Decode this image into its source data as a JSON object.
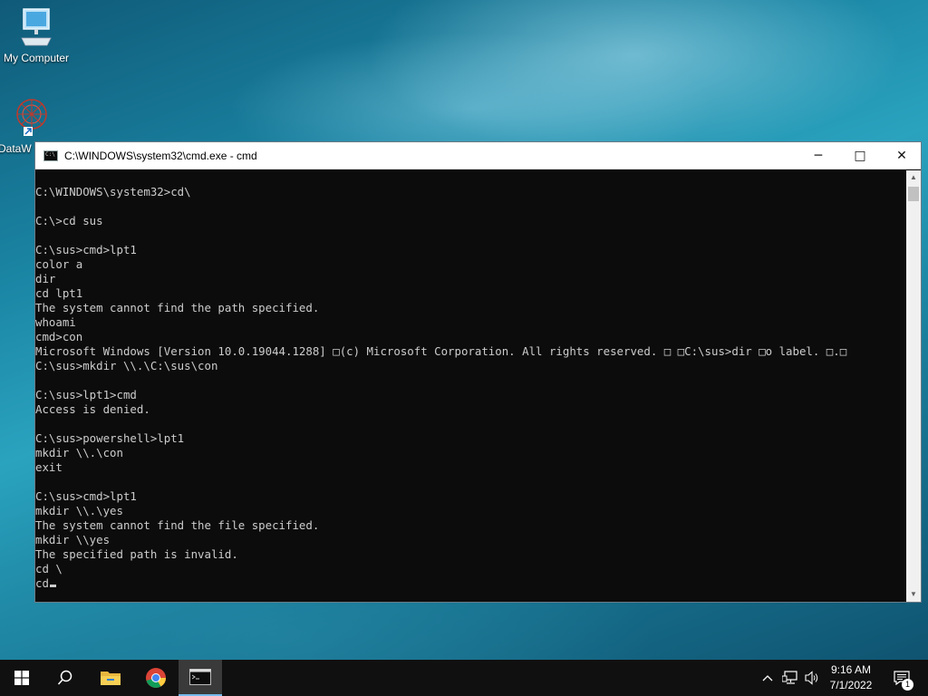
{
  "desktop": {
    "icons": [
      {
        "label": "My Computer",
        "icon": "computer-icon"
      },
      {
        "label": "DataW",
        "icon": "datawrapper-icon"
      }
    ]
  },
  "window": {
    "title": "C:\\WINDOWS\\system32\\cmd.exe - cmd",
    "buttons": {
      "minimize": "─",
      "maximize": "□",
      "close": "✕"
    }
  },
  "console": {
    "lines": [
      "C:\\WINDOWS\\system32>cd\\",
      "",
      "C:\\>cd sus",
      "",
      "C:\\sus>cmd>lpt1",
      "color a",
      "dir",
      "cd lpt1",
      "The system cannot find the path specified.",
      "whoami",
      "cmd>con",
      "Microsoft Windows [Version 10.0.19044.1288] \u0000(c) Microsoft Corporation. All rights reserved. \u0000 \u0000C:\\sus>dir \u0000o label. \u0000.\u0000",
      "C:\\sus>mkdir \\\\.\\C:\\sus\\con",
      "",
      "C:\\sus>lpt1>cmd",
      "Access is denied.",
      "",
      "C:\\sus>powershell>lpt1",
      "mkdir \\\\.\\con",
      "exit",
      "",
      "C:\\sus>cmd>lpt1",
      "mkdir \\\\.\\yes",
      "The system cannot find the file specified.",
      "mkdir \\\\yes",
      "The specified path is invalid.",
      "cd \\",
      "cd"
    ]
  },
  "taskbar": {
    "items": [
      {
        "name": "start-button",
        "icon": "windows-logo-icon"
      },
      {
        "name": "search-button",
        "icon": "search-icon"
      },
      {
        "name": "file-explorer-button",
        "icon": "folder-icon"
      },
      {
        "name": "chrome-button",
        "icon": "chrome-icon"
      },
      {
        "name": "cmd-button",
        "icon": "terminal-icon"
      }
    ],
    "clock": {
      "time": "9:16 AM",
      "date": "7/1/2022"
    },
    "notification_count": "1"
  }
}
